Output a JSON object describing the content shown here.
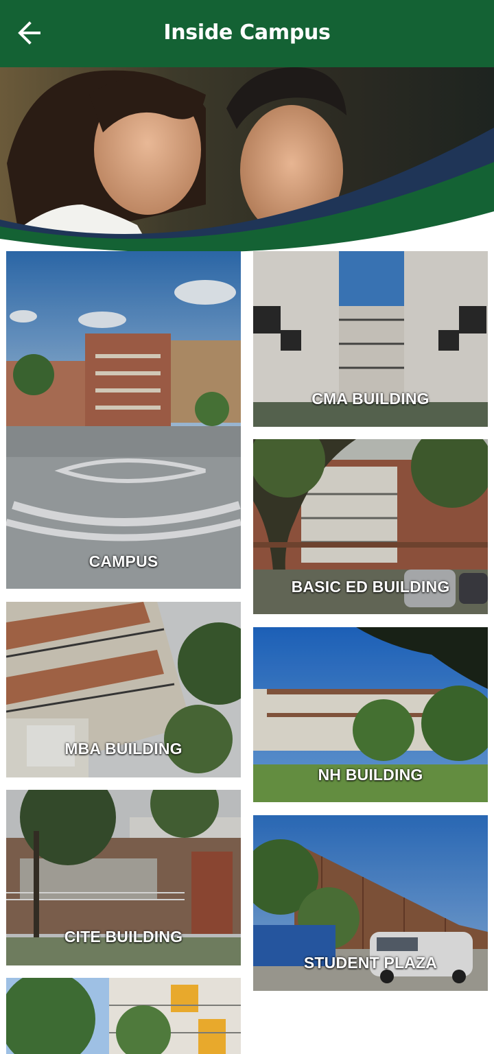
{
  "header": {
    "title": "Inside Campus",
    "back_icon": "arrow-left-icon",
    "background_color": "#146234"
  },
  "hero": {
    "image": "students-smiling-photo",
    "wave_colors": [
      "#1f3557",
      "#146234"
    ]
  },
  "tiles": [
    {
      "label": "CAMPUS"
    },
    {
      "label": "CMA BUILDING"
    },
    {
      "label": "BASIC ED BUILDING"
    },
    {
      "label": "MBA BUILDING"
    },
    {
      "label": "NH BUILDING"
    },
    {
      "label": "CITE BUILDING"
    },
    {
      "label": "STUDENT PLAZA"
    },
    {
      "label": ""
    }
  ]
}
